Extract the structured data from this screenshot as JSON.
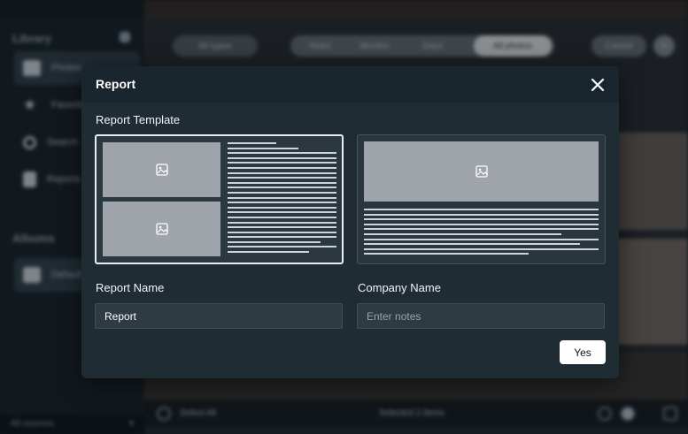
{
  "background": {
    "sidebar": {
      "library_title": "Library",
      "items": [
        {
          "label": "Photos",
          "icon": "photos-icon"
        },
        {
          "label": "Favorites",
          "icon": "star-icon"
        },
        {
          "label": "Search",
          "icon": "search-icon"
        },
        {
          "label": "Reports",
          "icon": "document-icon"
        }
      ],
      "albums_title": "Albums",
      "albums": [
        {
          "label": "Default",
          "icon": "photos-icon"
        }
      ],
      "bottom_select": "All sources"
    },
    "topbar": {
      "sort_pill": "All types",
      "view_tabs": [
        "Years",
        "Months",
        "Days",
        "All photos"
      ],
      "active_tab": "All photos",
      "cancel_label": "Cancel"
    },
    "bottombar": {
      "select_all": "Select All",
      "selected_count": "Selected 2 items"
    }
  },
  "modal": {
    "title": "Report",
    "template_label": "Report Template",
    "templates": [
      {
        "name": "two-images-with-text",
        "selected": true
      },
      {
        "name": "banner-image-with-text",
        "selected": false
      }
    ],
    "report_name_label": "Report Name",
    "report_name_value": "Report",
    "company_name_label": "Company Name",
    "company_name_placeholder": "Enter notes",
    "confirm_label": "Yes"
  }
}
